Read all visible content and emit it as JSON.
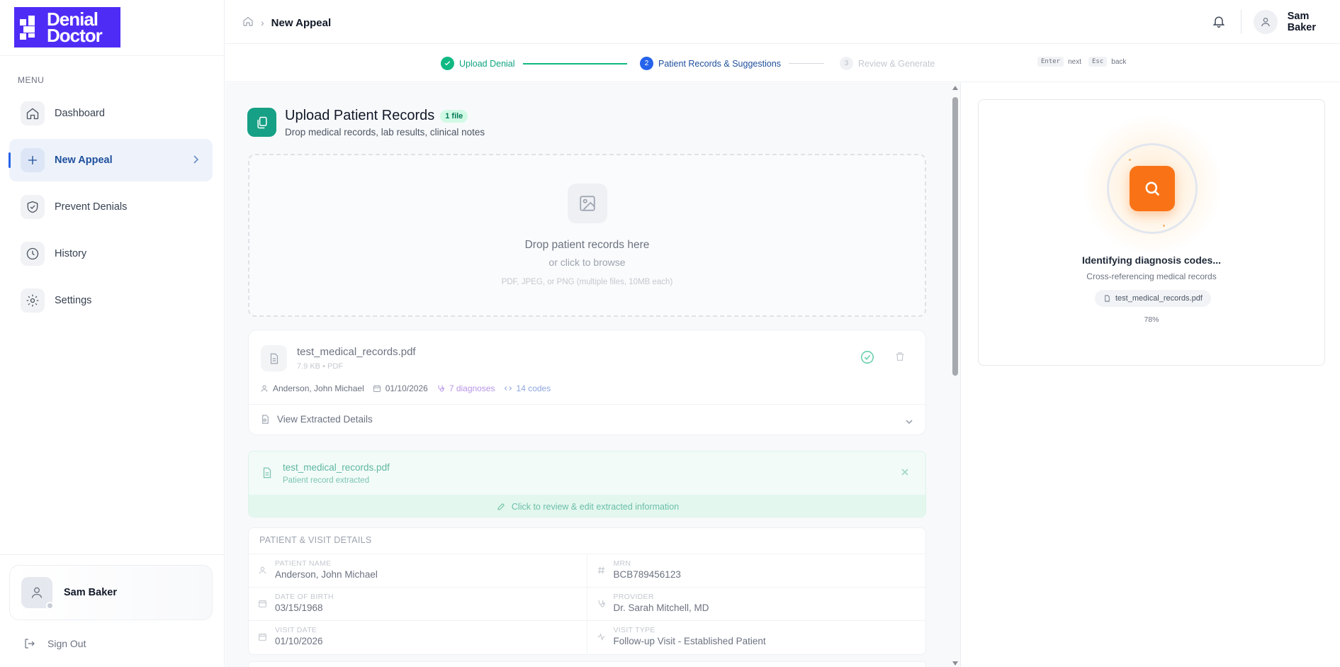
{
  "brand": {
    "line1": "Denial",
    "line2": "Doctor",
    "color": "#4f2cf5"
  },
  "sidebar": {
    "menu_label": "MENU",
    "items": [
      {
        "label": "Dashboard",
        "icon": "home-icon"
      },
      {
        "label": "New Appeal",
        "icon": "plus-icon",
        "active": true
      },
      {
        "label": "Prevent Denials",
        "icon": "shield-check-icon"
      },
      {
        "label": "History",
        "icon": "clock-icon"
      },
      {
        "label": "Settings",
        "icon": "gear-icon"
      }
    ],
    "user_name": "Sam Baker",
    "sign_out": "Sign Out"
  },
  "header": {
    "breadcrumb_current": "New Appeal",
    "user_name": "Sam Baker"
  },
  "stepper": {
    "steps": [
      {
        "number": "1",
        "label": "Upload Denial",
        "status": "done"
      },
      {
        "number": "2",
        "label": "Patient Records & Suggestions",
        "status": "current"
      },
      {
        "number": "3",
        "label": "Review & Generate",
        "status": "pending"
      }
    ],
    "hint_enter_key": "Enter",
    "hint_enter_text": "next",
    "hint_esc_key": "Esc",
    "hint_esc_text": "back"
  },
  "upload": {
    "title": "Upload Patient Records",
    "badge": "1 file",
    "subtitle": "Drop medical records, lab results, clinical notes",
    "drop_title": "Drop patient records here",
    "drop_browse": "or click to browse",
    "drop_formats": "PDF, JPEG, or PNG (multiple files, 10MB each)"
  },
  "file_card": {
    "name": "test_medical_records.pdf",
    "meta": "7.9 KB • PDF",
    "patient": "Anderson, John Michael",
    "date": "01/10/2026",
    "diagnoses": "7 diagnoses",
    "codes": "14 codes",
    "view_details": "View Extracted Details"
  },
  "extracted": {
    "name": "test_medical_records.pdf",
    "status": "Patient record extracted",
    "edit_cta": "Click to review & edit extracted information"
  },
  "details": {
    "title": "PATIENT & VISIT DETAILS",
    "fields": [
      {
        "label": "PATIENT NAME",
        "value": "Anderson, John Michael",
        "icon": "user-icon"
      },
      {
        "label": "MRN",
        "value": "BCB789456123",
        "icon": "hash-icon"
      },
      {
        "label": "DATE OF BIRTH",
        "value": "03/15/1968",
        "icon": "calendar-icon"
      },
      {
        "label": "PROVIDER",
        "value": "Dr. Sarah Mitchell, MD",
        "icon": "stethoscope-icon"
      },
      {
        "label": "VISIT DATE",
        "value": "01/10/2026",
        "icon": "calendar-icon"
      },
      {
        "label": "VISIT TYPE",
        "value": "Follow-up Visit - Established Patient",
        "icon": "activity-icon"
      }
    ]
  },
  "processing": {
    "title": "Identifying diagnosis codes...",
    "subtitle": "Cross-referencing medical records",
    "file": "test_medical_records.pdf",
    "percent": "78%",
    "accent": "#f97316"
  }
}
